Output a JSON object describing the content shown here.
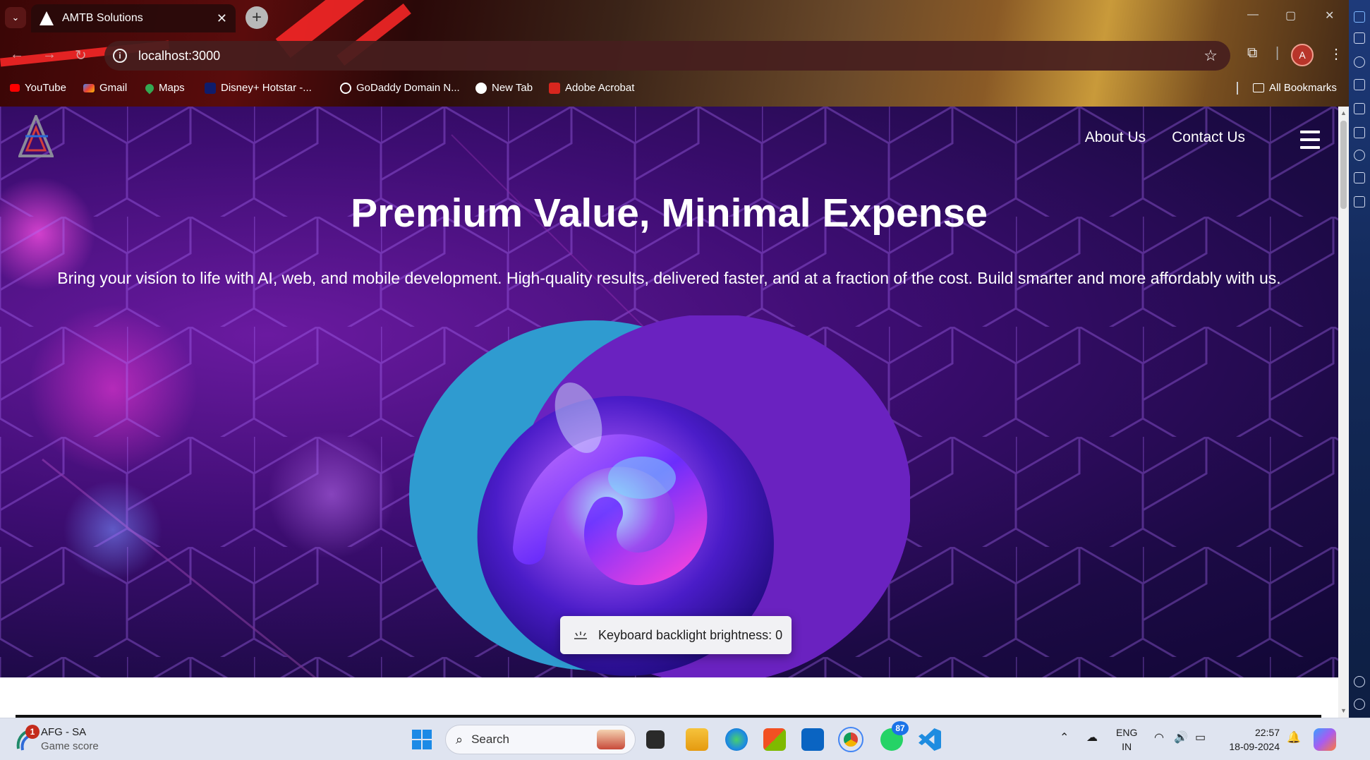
{
  "browser": {
    "tab_title": "AMTB Solutions",
    "url": "localhost:3000",
    "bookmarks": [
      {
        "label": "YouTube",
        "color": "#ff0000"
      },
      {
        "label": "Gmail",
        "color": "#ea4335"
      },
      {
        "label": "Maps",
        "color": "#34a853"
      },
      {
        "label": "Disney+ Hotstar -...",
        "color": "#0f1c6b"
      },
      {
        "label": "GoDaddy Domain N...",
        "color": "#ffffff"
      },
      {
        "label": "New Tab",
        "color": "#ffffff"
      },
      {
        "label": "Adobe Acrobat",
        "color": "#d7261e"
      }
    ],
    "all_bookmarks_label": "All Bookmarks",
    "profile_initial": "A"
  },
  "site": {
    "nav": {
      "about_label": "About Us",
      "contact_label": "Contact Us"
    },
    "hero": {
      "title": "Premium Value, Minimal Expense",
      "subtitle": "Bring your vision to life with AI, web, and mobile development. High-quality results, delivered faster, and at a fraction of the cost. Build smarter and more affordably with us."
    },
    "colors": {
      "hero_bg": "#3d0d72",
      "circle_left": "#2f9bd0",
      "circle_right": "#6a22c0",
      "accent_glow": "#ff50e6"
    }
  },
  "toast": {
    "text": "Keyboard backlight brightness: 0"
  },
  "taskbar": {
    "weather_title": "AFG - SA",
    "weather_sub": "Game score",
    "weather_badge": "1",
    "search_label": "Search",
    "whatsapp_badge": "87",
    "lang_top": "ENG",
    "lang_bottom": "IN",
    "time": "22:57",
    "date": "18-09-2024"
  }
}
